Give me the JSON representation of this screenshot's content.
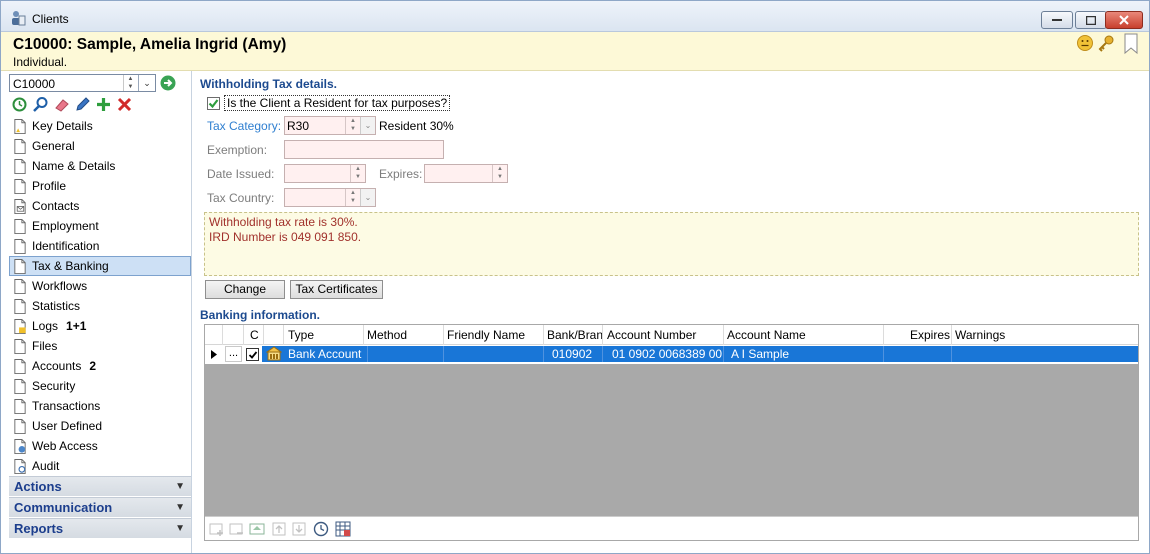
{
  "window": {
    "title": "Clients"
  },
  "header": {
    "client_title": "C10000: Sample, Amelia Ingrid (Amy)",
    "client_type": "Individual."
  },
  "sidebar": {
    "client_code": "C10000",
    "items": [
      {
        "label": "Key Details",
        "badge": ""
      },
      {
        "label": "General",
        "badge": ""
      },
      {
        "label": "Name & Details",
        "badge": ""
      },
      {
        "label": "Profile",
        "badge": ""
      },
      {
        "label": "Contacts",
        "badge": ""
      },
      {
        "label": "Employment",
        "badge": ""
      },
      {
        "label": "Identification",
        "badge": ""
      },
      {
        "label": "Tax & Banking",
        "badge": "",
        "selected": true
      },
      {
        "label": "Workflows",
        "badge": ""
      },
      {
        "label": "Statistics",
        "badge": ""
      },
      {
        "label": "Logs",
        "badge": "1+1"
      },
      {
        "label": "Files",
        "badge": ""
      },
      {
        "label": "Accounts",
        "badge": "2"
      },
      {
        "label": "Security",
        "badge": ""
      },
      {
        "label": "Transactions",
        "badge": ""
      },
      {
        "label": "User Defined",
        "badge": ""
      },
      {
        "label": "Web Access",
        "badge": ""
      },
      {
        "label": "Audit",
        "badge": ""
      }
    ],
    "sections": [
      "Actions",
      "Communication",
      "Reports"
    ]
  },
  "withholding": {
    "title": "Withholding Tax details.",
    "resident_label": "Is the Client a Resident for tax purposes?",
    "resident_checked": true,
    "tax_category_label": "Tax Category:",
    "tax_category_value": "R30",
    "tax_category_desc": "Resident 30%",
    "exemption_label": "Exemption:",
    "date_issued_label": "Date Issued:",
    "expires_label": "Expires:",
    "tax_country_label": "Tax Country:",
    "info_lines": [
      "Withholding tax rate is 30%.",
      "IRD Number is 049 091 850."
    ],
    "change_button": "Change",
    "certificates_button": "Tax Certificates"
  },
  "banking": {
    "title": "Banking information.",
    "columns": {
      "c": "C",
      "type": "Type",
      "method": "Method",
      "friendly": "Friendly Name",
      "bank": "Bank/Bran",
      "account_number": "Account Number",
      "account_name": "Account Name",
      "expires": "Expires",
      "warnings": "Warnings"
    },
    "rows": [
      {
        "type": "Bank Account",
        "method": "",
        "friendly": "",
        "bank": "010902",
        "account_number": "01 0902 0068389 00",
        "account_name": "A I Sample",
        "expires": "",
        "warnings": "",
        "checked": true
      }
    ]
  },
  "colors": {
    "header_bg": "#fdf9d7",
    "selection": "#1976d7",
    "section_title": "#1c4a8f",
    "info_text": "#a1312c"
  }
}
